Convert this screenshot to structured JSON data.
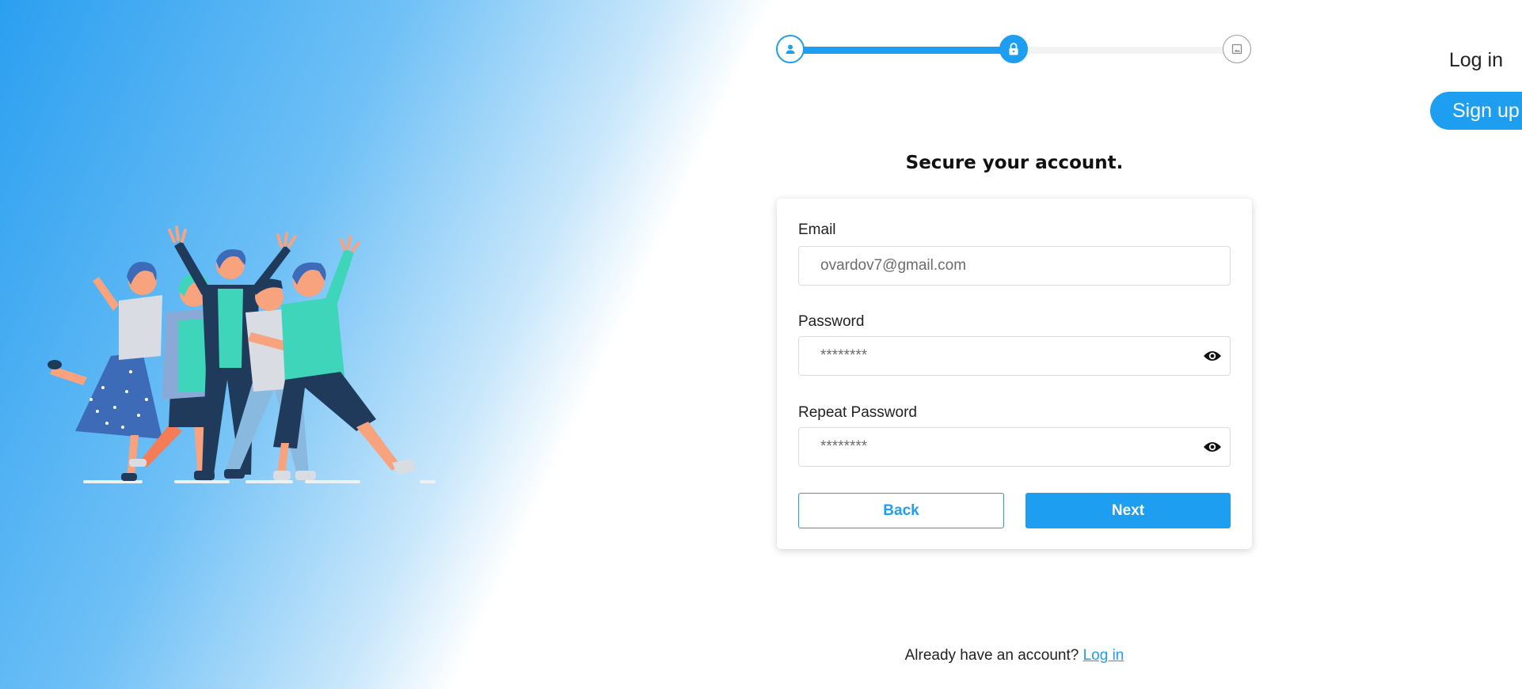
{
  "nav": {
    "login_label": "Log in",
    "signup_label": "Sign up"
  },
  "stepper": {
    "steps": [
      {
        "icon": "user-icon",
        "state": "complete"
      },
      {
        "icon": "lock-icon",
        "state": "active"
      },
      {
        "icon": "image-icon",
        "state": "pending"
      }
    ],
    "progress": 0.5,
    "accent_color": "#1d9ef0"
  },
  "form": {
    "heading": "Secure your account.",
    "email": {
      "label": "Email",
      "value": "ovardov7@gmail.com"
    },
    "password": {
      "label": "Password",
      "value": "********",
      "toggle_icon": "eye-icon"
    },
    "repeat_password": {
      "label": "Repeat Password",
      "value": "********",
      "toggle_icon": "eye-icon"
    },
    "back_label": "Back",
    "next_label": "Next"
  },
  "footer": {
    "prompt": "Already have an account?",
    "link_label": "Log in"
  },
  "colors": {
    "accent": "#1d9ef0",
    "gradient_start": "#2b9ff0"
  }
}
